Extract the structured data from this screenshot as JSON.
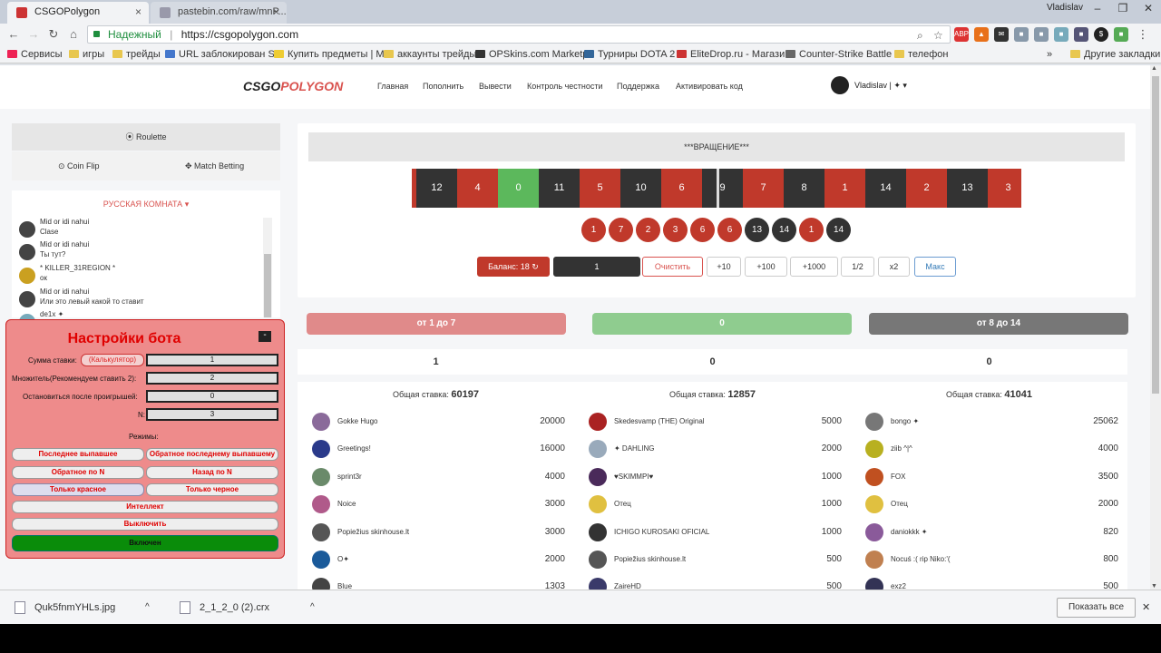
{
  "browser": {
    "tabs": [
      {
        "title": "CSGOPolygon",
        "close": "×"
      },
      {
        "title": "pastebin.com/raw/mnP...",
        "close": "×"
      }
    ],
    "user": "Vladislav",
    "window_controls": [
      "–",
      "❐",
      "✕"
    ],
    "secure_label": "Надежный",
    "url": "https://csgopolygon.com",
    "bookmarks": [
      "Сервисы",
      "игры",
      "трейды",
      "URL заблокирован S",
      "Купить предметы | М",
      "аккаунты трейды",
      "OPSkins.com Marketp",
      "Турниры DOTA 2",
      "EliteDrop.ru - Магази",
      "Counter-Strike Battle",
      "телефон",
      "Другие закладки"
    ],
    "bookmarks_more": "»"
  },
  "site": {
    "logo_a": "CSGO",
    "logo_b": "POLYGON",
    "nav": [
      "Главная",
      "Пополнить",
      "Вывести",
      "Контроль честности",
      "Поддержка",
      "Активировать код"
    ],
    "user_menu": "Vladislav | ✦ ▾"
  },
  "modes": {
    "roulette": "⦿ Roulette",
    "coinflip": "⊙ Coin Flip",
    "match": "✥ Match Betting"
  },
  "chat": {
    "room": "РУССКАЯ КОМНАТА ▾",
    "messages": [
      {
        "name": "Mid or idi nahui",
        "text": "Clase"
      },
      {
        "name": "Mid or idi nahui",
        "text": "Ты тут?"
      },
      {
        "name": "* KILLER_31REGION *",
        "text": "ок"
      },
      {
        "name": "Mid or idi nahui",
        "text": "Или это левый какой то ставит"
      },
      {
        "name": "de1x ✦",
        "text": ""
      }
    ]
  },
  "bot": {
    "title": "Настройки бота",
    "minimize": "-",
    "sum_label": "Сумма ставки:",
    "calc": "(Калькулятор)",
    "sum_value": "1",
    "mult_label": "Множитель(Рекомендуем ставить 2):",
    "mult_value": "2",
    "stop_label": "Остановиться после проигрышей:",
    "stop_value": "0",
    "n_label": "N:",
    "n_value": "3",
    "modes_label": "Режимы:",
    "buttons": [
      "Последнее выпавшее",
      "Обратное последнему выпавшему",
      "Обратное по N",
      "Назад по N",
      "Только красное",
      "Только черное",
      "Интеллект",
      "Выключить",
      "Включен"
    ],
    "gear": "⚙"
  },
  "roulette": {
    "status": "***ВРАЩЕНИЕ***",
    "wheel": [
      {
        "n": "",
        "c": "red"
      },
      {
        "n": "12",
        "c": "blk"
      },
      {
        "n": "4",
        "c": "red"
      },
      {
        "n": "0",
        "c": "grn"
      },
      {
        "n": "11",
        "c": "blk"
      },
      {
        "n": "5",
        "c": "red"
      },
      {
        "n": "10",
        "c": "blk"
      },
      {
        "n": "6",
        "c": "red"
      },
      {
        "n": "9",
        "c": "blk"
      },
      {
        "n": "7",
        "c": "red"
      },
      {
        "n": "8",
        "c": "blk"
      },
      {
        "n": "1",
        "c": "red"
      },
      {
        "n": "14",
        "c": "blk"
      },
      {
        "n": "2",
        "c": "red"
      },
      {
        "n": "13",
        "c": "blk"
      },
      {
        "n": "3",
        "c": "red"
      }
    ],
    "history": [
      {
        "n": "1",
        "c": "red"
      },
      {
        "n": "7",
        "c": "red"
      },
      {
        "n": "2",
        "c": "red"
      },
      {
        "n": "3",
        "c": "red"
      },
      {
        "n": "6",
        "c": "red"
      },
      {
        "n": "6",
        "c": "red"
      },
      {
        "n": "13",
        "c": "blk"
      },
      {
        "n": "14",
        "c": "blk"
      },
      {
        "n": "1",
        "c": "red"
      },
      {
        "n": "14",
        "c": "blk"
      }
    ],
    "balance": "Баланс: 18 ↻",
    "bet_amount": "1",
    "controls": [
      "Очистить",
      "+10",
      "+100",
      "+1000",
      "1/2",
      "x2",
      "Макс"
    ]
  },
  "columns": [
    {
      "label": "от 1 до 7",
      "color": "#e08a8a",
      "my_bet": "1",
      "total_label": "Общая ставка:",
      "total": "60197",
      "rows": [
        {
          "name": "Gokke Hugo",
          "v": "20000",
          "av": "#8a6a9a"
        },
        {
          "name": "Greetings!",
          "v": "16000",
          "av": "#2a3a8a"
        },
        {
          "name": "sprint3r",
          "v": "4000",
          "av": "#6a8a6a"
        },
        {
          "name": "Noice",
          "v": "3000",
          "av": "#b05a8a"
        },
        {
          "name": "Popiežius skinhouse.lt",
          "v": "3000",
          "av": "#555"
        },
        {
          "name": "O✦",
          "v": "2000",
          "av": "#1a5a9a"
        },
        {
          "name": "Blue",
          "v": "1303",
          "av": "#444"
        }
      ]
    },
    {
      "label": "0",
      "color": "#8fcc8f",
      "my_bet": "0",
      "total_label": "Общая ставка:",
      "total": "12857",
      "rows": [
        {
          "name": "Skedesvamp (THE) Original",
          "v": "5000",
          "av": "#a22"
        },
        {
          "name": "✦ DAHLING",
          "v": "2000",
          "av": "#9ab"
        },
        {
          "name": "♥SKIMMPI♥",
          "v": "1000",
          "av": "#4a2a5a"
        },
        {
          "name": "Отец",
          "v": "1000",
          "av": "#e0c040"
        },
        {
          "name": "ICHIGO KUROSAKI OFICIAL",
          "v": "1000",
          "av": "#333"
        },
        {
          "name": "Popiežius skinhouse.lt",
          "v": "500",
          "av": "#555"
        },
        {
          "name": "ZaireHD",
          "v": "500",
          "av": "#3a3a6a"
        }
      ]
    },
    {
      "label": "от 8 до 14",
      "color": "#777777",
      "my_bet": "0",
      "total_label": "Общая ставка:",
      "total": "41041",
      "rows": [
        {
          "name": "bongo ✦",
          "v": "25062",
          "av": "#777"
        },
        {
          "name": "ziib ^|^",
          "v": "4000",
          "av": "#b8b020"
        },
        {
          "name": "FOX",
          "v": "3500",
          "av": "#c05020"
        },
        {
          "name": "Отец",
          "v": "2000",
          "av": "#e0c040"
        },
        {
          "name": "daniokkk ✦",
          "v": "820",
          "av": "#8a5a9a"
        },
        {
          "name": "Nocuś :( rip Niko:'(",
          "v": "800",
          "av": "#c08050"
        },
        {
          "name": "exz2",
          "v": "500",
          "av": "#335"
        }
      ]
    }
  ],
  "downloads": {
    "items": [
      "Quk5fnmYHLs.jpg",
      "2_1_2_0 (2).crx"
    ],
    "show_all": "Показать все",
    "close": "✕"
  }
}
